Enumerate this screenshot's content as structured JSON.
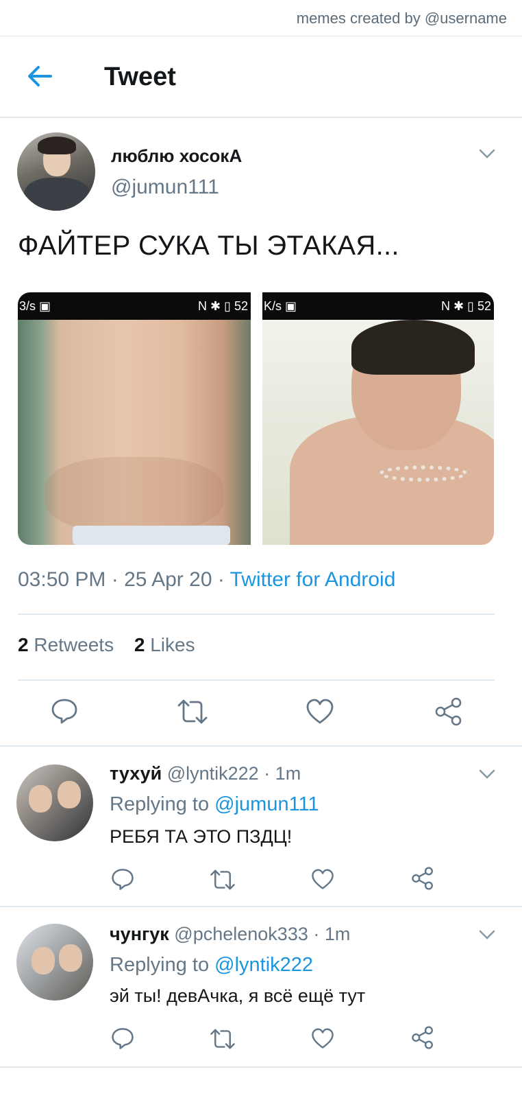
{
  "watermark": "memes created by @username",
  "header": {
    "title": "Tweet"
  },
  "tweet": {
    "author_name": "люблю хосокА",
    "author_handle": "@jumun111",
    "text": "ФАЙТЕР СУКА ТЫ ЭТАКАЯ...",
    "media": [
      {
        "status_left": "3/s ▣",
        "status_right": "N ✱ ▯ 52"
      },
      {
        "status_left": "K/s ▣",
        "status_right": "N ✱ ▯ 52"
      }
    ],
    "time_date": "03:50 PM · 25 Apr 20 · ",
    "source": "Twitter for Android",
    "retweets_count": "2",
    "retweets_label": "Retweets",
    "likes_count": "2",
    "likes_label": "Likes"
  },
  "replies": [
    {
      "name": "тухуй",
      "handle_time": "@lyntik222 · 1m",
      "replying_prefix": "Replying to ",
      "replying_to": "@jumun111",
      "text": "РЕБЯ ТА ЭТО ПЗДЦ!"
    },
    {
      "name": "чунгук",
      "handle_time": "@pchelenok333 · 1m",
      "replying_prefix": "Replying to ",
      "replying_to": "@lyntik222",
      "text": "эй ты! девАчка, я всё ещё тут"
    }
  ],
  "icons": [
    "back-arrow-icon",
    "chevron-down-icon",
    "reply-icon",
    "retweet-icon",
    "like-icon",
    "share-icon"
  ],
  "colors": {
    "accent": "#1b95e0",
    "text": "#14171a",
    "muted": "#657786",
    "divider": "#e1e8ed"
  }
}
